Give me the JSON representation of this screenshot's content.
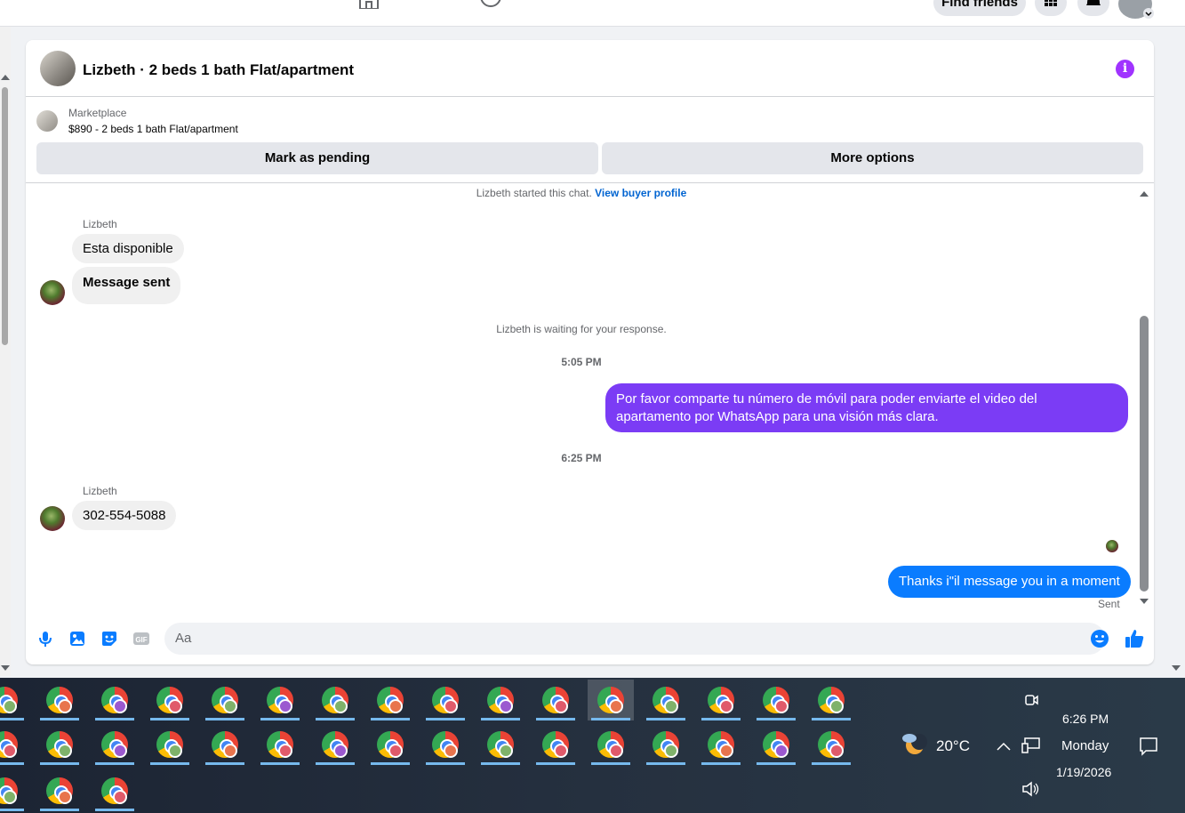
{
  "topbar": {
    "find_friends": "Find friends"
  },
  "chat": {
    "header_title": "Lizbeth · 2 beds 1 bath Flat/apartment",
    "info_icon": "info-icon",
    "marketplace_label": "Marketplace",
    "listing": "$890 - 2 beds 1 bath Flat/apartment",
    "mark_pending": "Mark as pending",
    "more_options": "More options",
    "started_text": "Lizbeth started this chat.",
    "view_profile": "View buyer profile",
    "messages": [
      {
        "sender": "Lizbeth",
        "text": "Esta disponible"
      },
      {
        "text": "Message sent"
      }
    ],
    "waiting_text": "Lizbeth is waiting for your response.",
    "time_1": "5:05 PM",
    "out_message_1_line1": "Por favor comparte tu número de móvil para poder enviarte el video del",
    "out_message_1_line2": "apartamento por WhatsApp para una visión más clara.",
    "time_2": "6:25 PM",
    "sender_2": "Lizbeth",
    "in_message_2": "302-554-5088",
    "out_message_2": "Thanks i\"il message you in a moment",
    "sent_status": "Sent",
    "input_placeholder": "Aa",
    "accent_out_1": "#7b3cf5",
    "accent_out_2": "#0a7cff"
  },
  "taskbar": {
    "temperature": "20°C",
    "time": "6:26 PM",
    "day": "Monday",
    "date": "1/19/2026"
  }
}
